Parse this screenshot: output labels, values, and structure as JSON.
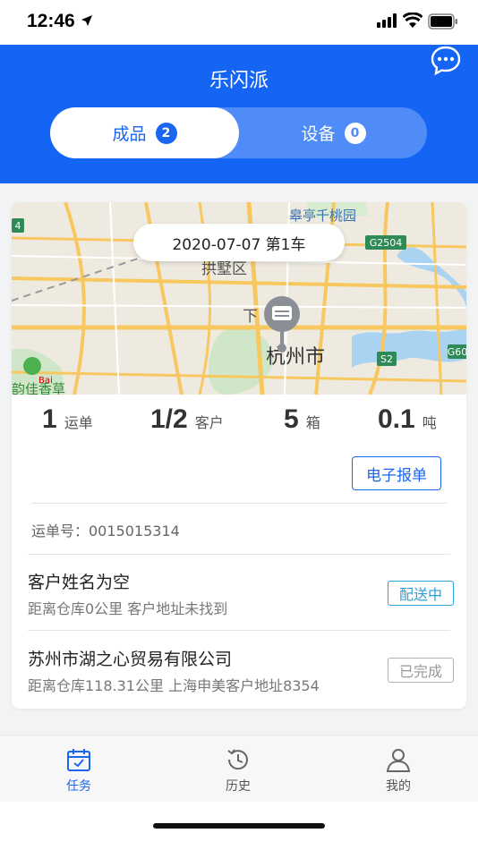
{
  "status_bar": {
    "time": "12:46"
  },
  "header": {
    "title": "乐闪派",
    "tabs": [
      {
        "label": "成品",
        "count": "2",
        "active": true
      },
      {
        "label": "设备",
        "count": "0",
        "active": false
      }
    ]
  },
  "map": {
    "date_label": "2020-07-07  第1车",
    "labels": {
      "city": "杭州市",
      "district": "拱墅区",
      "park": "皋亭千桃园",
      "road1": "G2504",
      "road2": "S2",
      "road3": "G60",
      "road4": "4",
      "poi": "韵佳香草",
      "partial": "下"
    },
    "watermark": "Bai"
  },
  "stats": [
    {
      "value": "1",
      "unit": "运单"
    },
    {
      "value": "1/2",
      "unit": "客户"
    },
    {
      "value": "5",
      "unit": "箱"
    },
    {
      "value": "0.1",
      "unit": "吨"
    }
  ],
  "report_button": "电子报单",
  "waybill": "运单号：0015015314",
  "customers": [
    {
      "name": "客户姓名为空",
      "detail": "距离仓库0公里  客户地址未找到",
      "status": "配送中"
    },
    {
      "name": "苏州市湖之心贸易有限公司",
      "detail": "距离仓库118.31公里  上海申美客户地址8354",
      "status": "已完成"
    }
  ],
  "tabbar": [
    {
      "label": "任务",
      "icon": "calendar-check-icon",
      "active": true
    },
    {
      "label": "历史",
      "icon": "history-clock-icon",
      "active": false
    },
    {
      "label": "我的",
      "icon": "person-icon",
      "active": false
    }
  ],
  "colors": {
    "primary": "#1565f5",
    "accent": "#1a66f0",
    "delivering": "#2aa0d8",
    "done": "#999999"
  }
}
